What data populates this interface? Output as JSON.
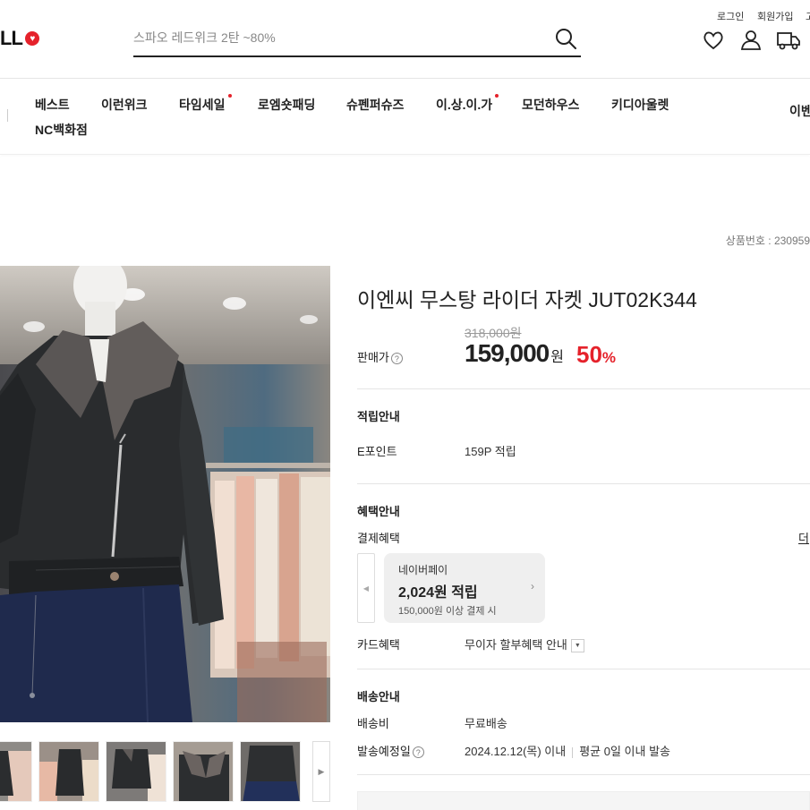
{
  "header": {
    "logo_text": "LL",
    "search_placeholder": "스파오 레드위크 2탄 ~80%",
    "util_links": [
      "로그인",
      "회원가입",
      "고"
    ],
    "icons": [
      "heart-icon",
      "user-icon",
      "delivery-truck-icon"
    ]
  },
  "gnb": {
    "items": [
      "베스트",
      "이런위크",
      "타임세일",
      "로엠숏패딩",
      "슈펜퍼슈즈",
      "이.상.이.가",
      "모던하우스",
      "키디아울렛"
    ],
    "items_row2": [
      "NC백화점"
    ],
    "right_label": "이벤"
  },
  "product": {
    "number_label": "상품번호 : 230959",
    "title": "이엔씨 무스탕 라이더 자켓 JUT02K344",
    "price_label": "판매가",
    "original_price": "318,000원",
    "price": "159,000",
    "price_unit": "원",
    "discount": "50",
    "discount_unit": "%",
    "point": {
      "section": "적립안내",
      "label": "E포인트",
      "value": "159P 적립"
    },
    "benefit": {
      "section": "혜택안내",
      "payment_label": "결제혜택",
      "more_link": "더",
      "card": {
        "name": "네이버페이",
        "amount": "2,024원 적립",
        "condition": "150,000원 이상 결제 시"
      },
      "card_label": "카드혜택",
      "card_value": "무이자 할부혜택 안내"
    },
    "delivery": {
      "section": "배송안내",
      "fee_label": "배송비",
      "fee_value": "무료배송",
      "date_label": "발송예정일",
      "date_value": "2024.12.12(목) 이내",
      "avg_value": "평균 0일 이내 발송"
    }
  },
  "colors": {
    "accent": "#e5222b",
    "text": "#222222"
  }
}
